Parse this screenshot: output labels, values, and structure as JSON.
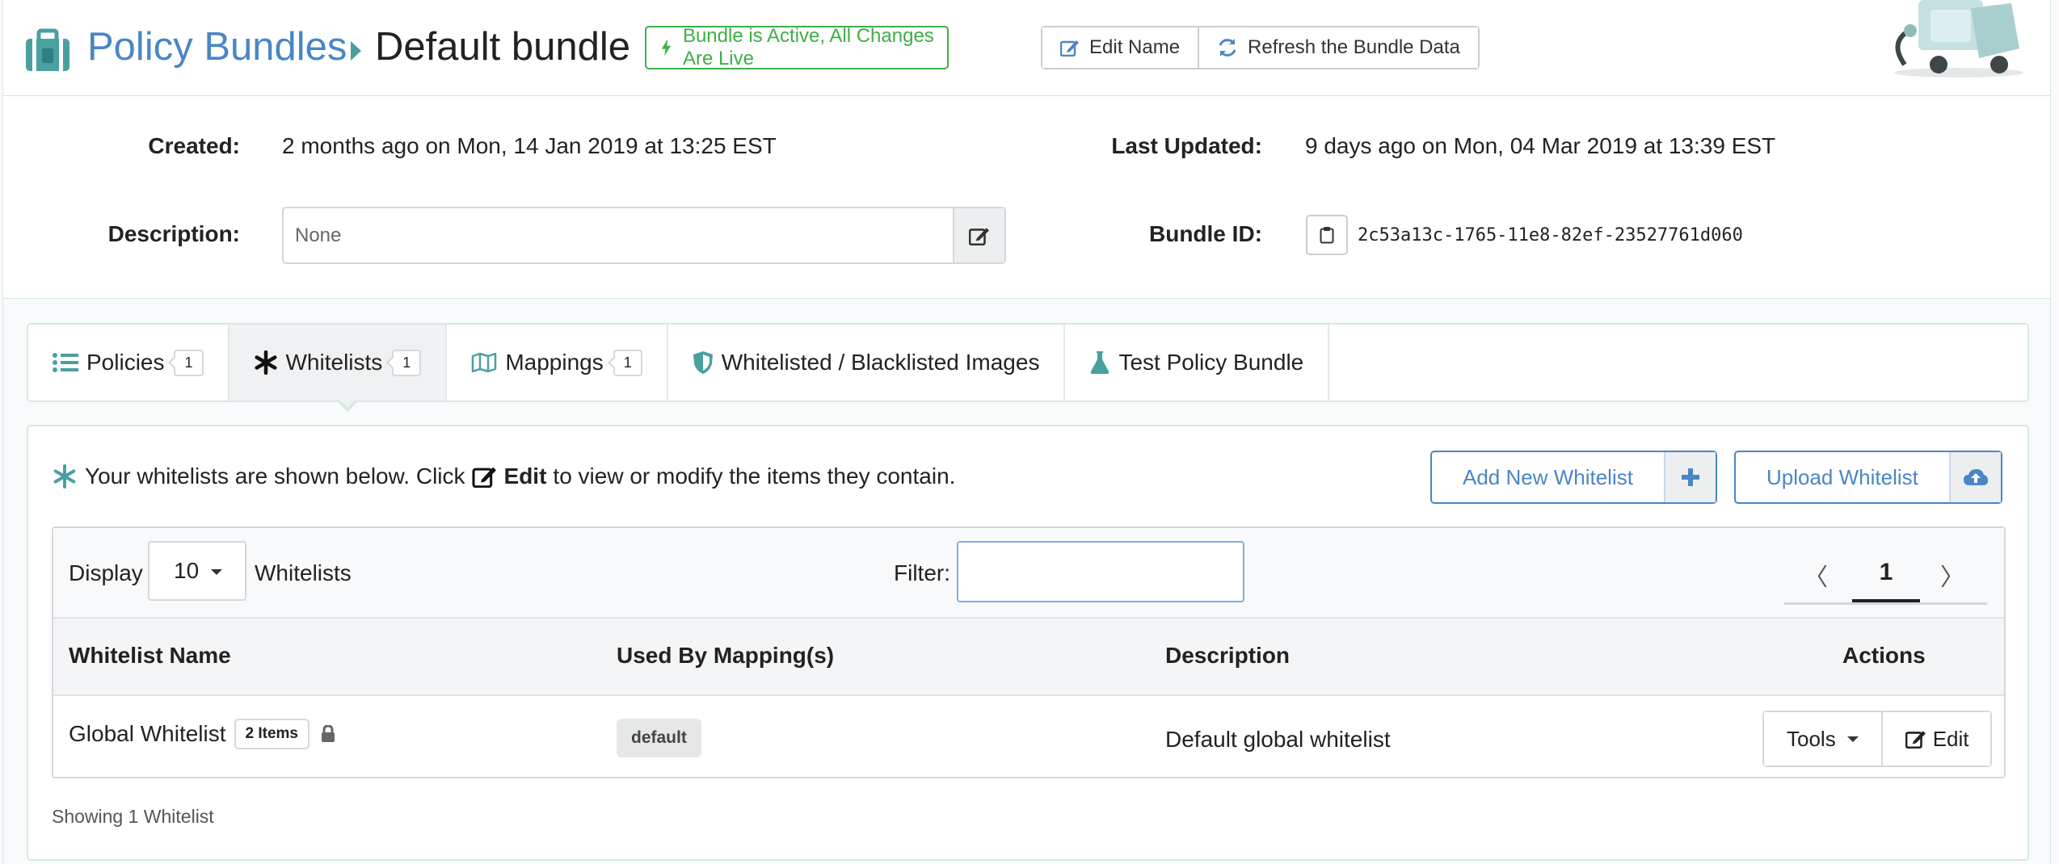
{
  "header": {
    "breadcrumb_root": "Policy Bundles",
    "breadcrumb_current": "Default bundle",
    "status_badge": "Bundle is Active, All Changes Are Live",
    "edit_name_label": "Edit Name",
    "refresh_label": "Refresh the Bundle Data"
  },
  "meta": {
    "created_label": "Created:",
    "created_value": "2 months ago on Mon, 14 Jan 2019 at 13:25 EST",
    "updated_label": "Last Updated:",
    "updated_value": "9 days ago on Mon, 04 Mar 2019 at 13:39 EST",
    "description_label": "Description:",
    "description_value": "None",
    "bundle_id_label": "Bundle ID:",
    "bundle_id_value": "2c53a13c-1765-11e8-82ef-23527761d060"
  },
  "tabs": [
    {
      "label": "Policies",
      "count": "1",
      "icon": "list-icon",
      "active": false
    },
    {
      "label": "Whitelists",
      "count": "1",
      "icon": "asterisk-icon",
      "active": true
    },
    {
      "label": "Mappings",
      "count": "1",
      "icon": "map-icon",
      "active": false
    },
    {
      "label": "Whitelisted / Blacklisted Images",
      "count": null,
      "icon": "shield-icon",
      "active": false
    },
    {
      "label": "Test Policy Bundle",
      "count": null,
      "icon": "flask-icon",
      "active": false
    }
  ],
  "panel": {
    "intro_pre": "Your whitelists are shown below. Click",
    "intro_edit": "Edit",
    "intro_post": "to view or modify the items they contain.",
    "add_button": "Add New Whitelist",
    "upload_button": "Upload Whitelist"
  },
  "table": {
    "display_label": "Display",
    "page_size": "10",
    "page_size_suffix": "Whitelists",
    "filter_label": "Filter:",
    "filter_value": "",
    "current_page": "1",
    "prev": "〈",
    "next": "〉",
    "columns": [
      "Whitelist Name",
      "Used By Mapping(s)",
      "Description",
      "Actions"
    ],
    "rows": [
      {
        "name": "Global Whitelist",
        "items_badge": "2 Items",
        "mapping": "default",
        "description": "Default global whitelist",
        "tools_label": "Tools",
        "edit_label": "Edit"
      }
    ],
    "footer": "Showing 1 Whitelist"
  },
  "colors": {
    "link_blue": "#4a86c5",
    "teal": "#4a9fa0",
    "live_green": "#3fae49"
  }
}
